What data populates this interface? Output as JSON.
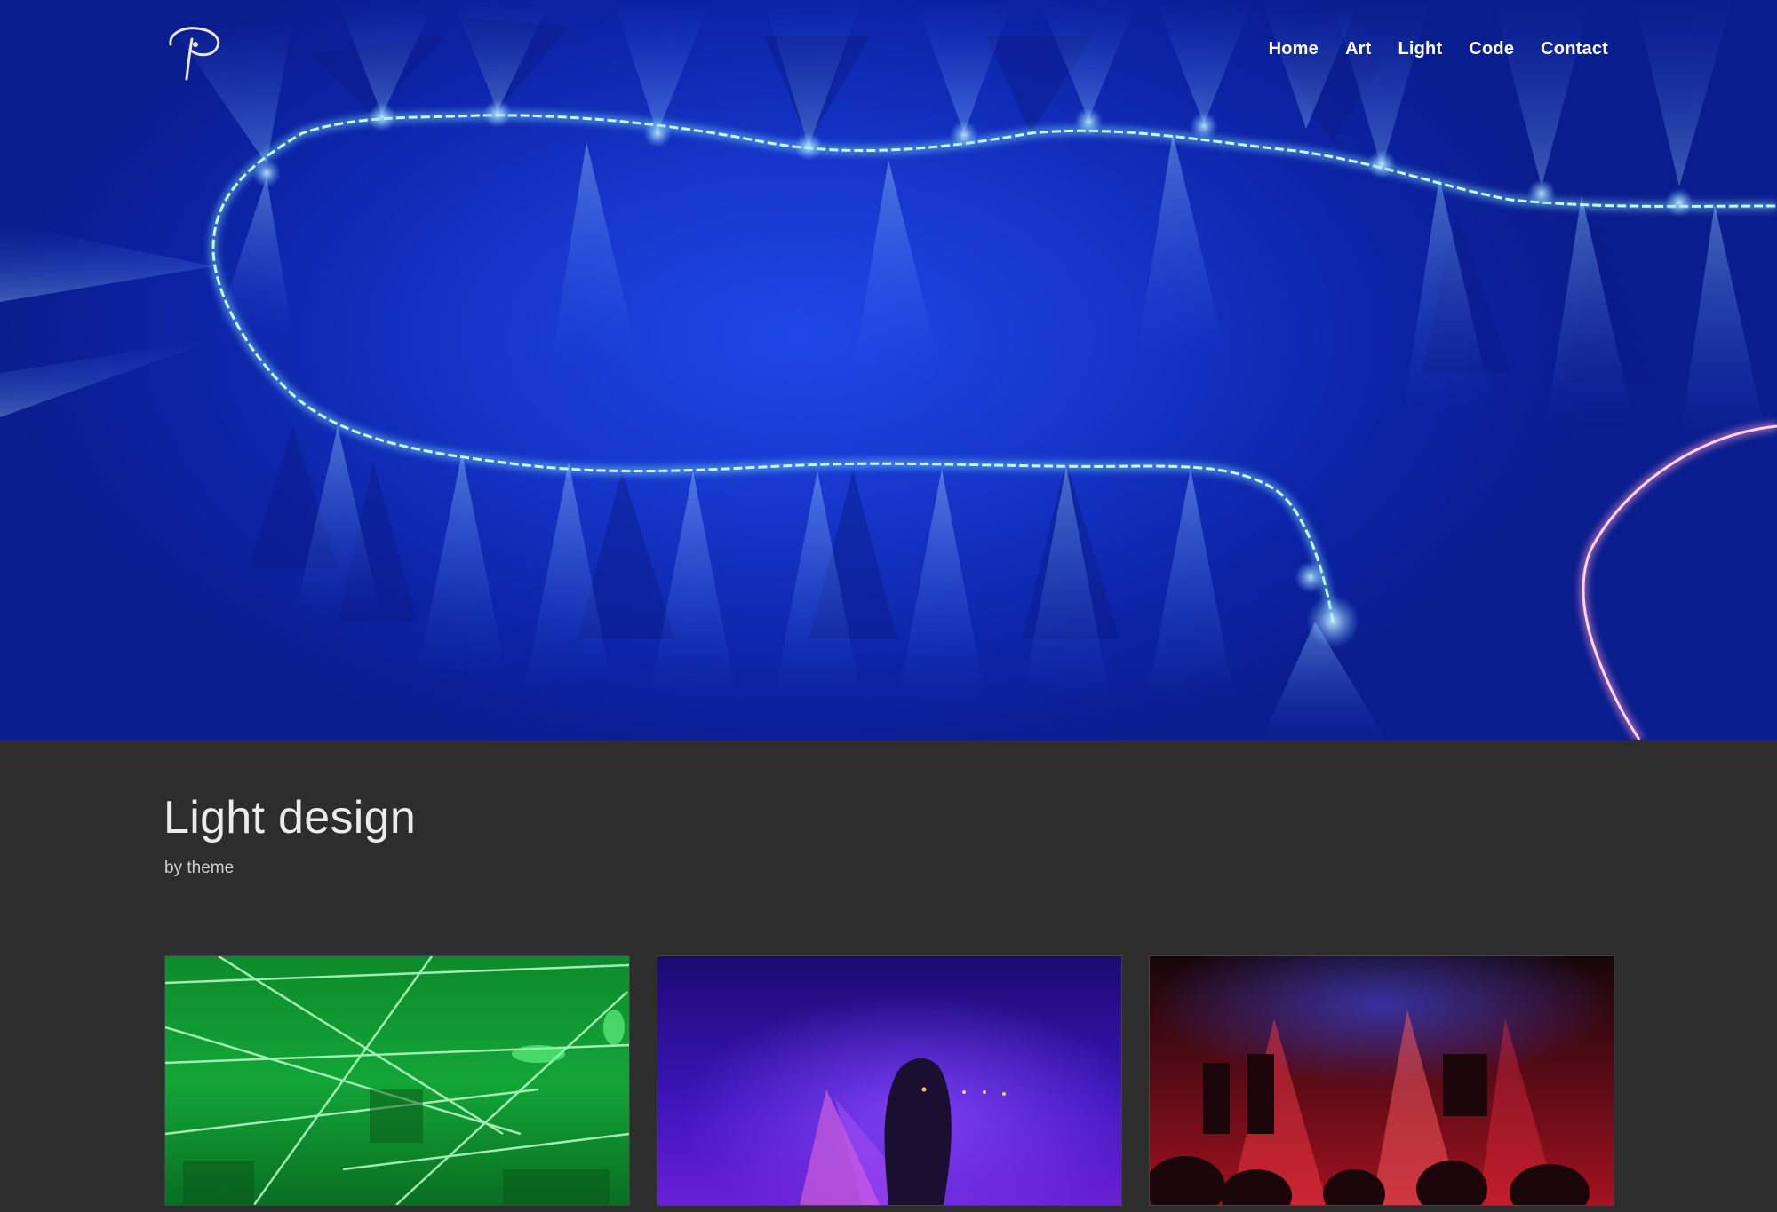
{
  "nav": {
    "items": [
      {
        "label": "Home"
      },
      {
        "label": "Art"
      },
      {
        "label": "Light"
      },
      {
        "label": "Code"
      },
      {
        "label": "Contact"
      }
    ]
  },
  "hero": {
    "logo_icon": "p-signature-logo-icon"
  },
  "main": {
    "title": "Light design",
    "byline_prefix": "by ",
    "byline_link": "theme"
  },
  "gallery": {
    "cards": [
      {
        "icon": "green-laser-photo",
        "accent": "#19c23a"
      },
      {
        "icon": "purple-performer-photo",
        "accent": "#6a1fd6"
      },
      {
        "icon": "red-stage-photo",
        "accent": "#e0202a"
      }
    ]
  },
  "colors": {
    "hero_blue": "#1536c9",
    "background": "#2d2d2d",
    "nav_text": "#ffffff"
  }
}
